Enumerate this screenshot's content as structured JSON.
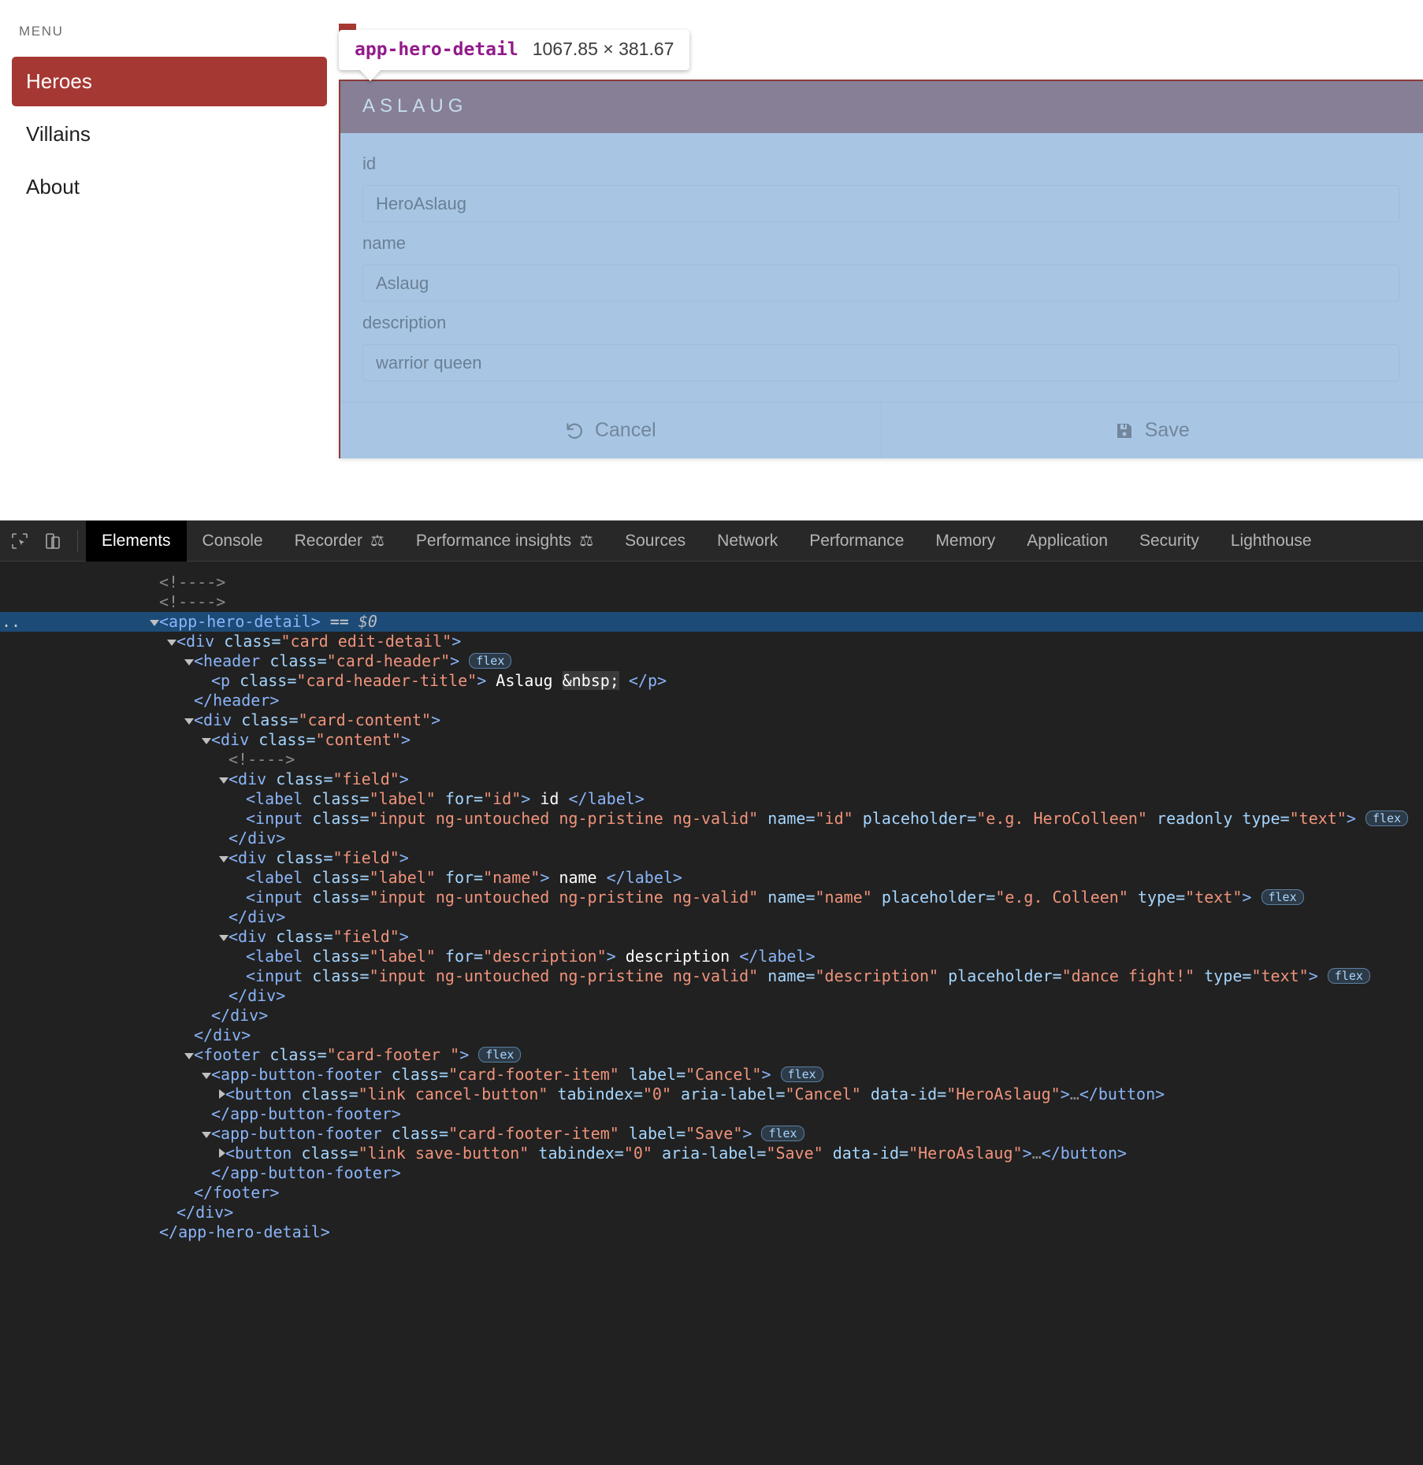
{
  "app": {
    "sidebar": {
      "menu_label": "MENU",
      "items": [
        {
          "label": "Heroes",
          "active": true
        },
        {
          "label": "Villains",
          "active": false
        },
        {
          "label": "About",
          "active": false
        }
      ]
    },
    "inspect_badge": {
      "tag": "app-hero-detail",
      "dimensions": "1067.85 × 381.67"
    },
    "card": {
      "title": "ASLAUG",
      "fields": [
        {
          "label": "id",
          "placeholder": "HeroAslaug"
        },
        {
          "label": "name",
          "placeholder": "Aslaug"
        },
        {
          "label": "description",
          "placeholder": "warrior queen"
        }
      ],
      "footer": {
        "cancel_label": "Cancel",
        "save_label": "Save"
      }
    }
  },
  "devtools": {
    "tabs": [
      {
        "label": "Elements",
        "active": true,
        "flask": false
      },
      {
        "label": "Console",
        "active": false,
        "flask": false
      },
      {
        "label": "Recorder",
        "active": false,
        "flask": true
      },
      {
        "label": "Performance insights",
        "active": false,
        "flask": true
      },
      {
        "label": "Sources",
        "active": false,
        "flask": false
      },
      {
        "label": "Network",
        "active": false,
        "flask": false
      },
      {
        "label": "Performance",
        "active": false,
        "flask": false
      },
      {
        "label": "Memory",
        "active": false,
        "flask": false
      },
      {
        "label": "Application",
        "active": false,
        "flask": false
      },
      {
        "label": "Security",
        "active": false,
        "flask": false
      },
      {
        "label": "Lighthouse",
        "active": false,
        "flask": false
      }
    ],
    "dom_lines": [
      {
        "indent": 1,
        "html": "<span class=\"cmt\">&lt;!----&gt;</span>"
      },
      {
        "indent": 1,
        "html": "<span class=\"cmt\">&lt;!----&gt;</span>"
      },
      {
        "indent": 1,
        "sel": true,
        "tri": "down",
        "html": "<span class=\"tag\">&lt;app-hero-detail&gt;</span> <span class=\"eq\">==</span> <span class=\"dollar\">$0</span>"
      },
      {
        "indent": 2,
        "tri": "down",
        "html": "<span class=\"tag\">&lt;div</span> <span class=\"attr\">class</span>=<span class=\"val\">\"card edit-detail\"</span><span class=\"tag\">&gt;</span>"
      },
      {
        "indent": 3,
        "tri": "down",
        "html": "<span class=\"tag\">&lt;header</span> <span class=\"attr\">class</span>=<span class=\"val\">\"card-header\"</span><span class=\"tag\">&gt;</span> <span class=\"flexbadge\">flex</span>"
      },
      {
        "indent": 4,
        "html": "<span class=\"tag\">&lt;p</span> <span class=\"attr\">class</span>=<span class=\"val\">\"card-header-title\"</span><span class=\"tag\">&gt;</span> <span class=\"txt\">Aslaug</span> <span class=\"nbsp-hl\">&amp;nbsp;</span> <span class=\"tag\">&lt;/p&gt;</span>"
      },
      {
        "indent": 3,
        "html": "<span class=\"tag\">&lt;/header&gt;</span>"
      },
      {
        "indent": 3,
        "tri": "down",
        "html": "<span class=\"tag\">&lt;div</span> <span class=\"attr\">class</span>=<span class=\"val\">\"card-content\"</span><span class=\"tag\">&gt;</span>"
      },
      {
        "indent": 4,
        "tri": "down",
        "html": "<span class=\"tag\">&lt;div</span> <span class=\"attr\">class</span>=<span class=\"val\">\"content\"</span><span class=\"tag\">&gt;</span>"
      },
      {
        "indent": 5,
        "html": "<span class=\"cmt\">&lt;!----&gt;</span>"
      },
      {
        "indent": 5,
        "tri": "down",
        "html": "<span class=\"tag\">&lt;div</span> <span class=\"attr\">class</span>=<span class=\"val\">\"field\"</span><span class=\"tag\">&gt;</span>"
      },
      {
        "indent": 6,
        "html": "<span class=\"tag\">&lt;label</span> <span class=\"attr\">class</span>=<span class=\"val\">\"label\"</span> <span class=\"attr\">for</span>=<span class=\"val\">\"id\"</span><span class=\"tag\">&gt;</span> <span class=\"txt\">id</span> <span class=\"tag\">&lt;/label&gt;</span>"
      },
      {
        "indent": 6,
        "html": "<span class=\"tag\">&lt;input</span> <span class=\"attr\">class</span>=<span class=\"val\">\"input ng-untouched ng-pristine ng-valid\"</span> <span class=\"attr\">name</span>=<span class=\"val\">\"id\"</span> <span class=\"attr\">placeholder</span>=<span class=\"val\">\"e.g. HeroColleen\"</span> <span class=\"attr\">readonly</span> <span class=\"attr\">type</span>=<span class=\"val\">\"text\"</span><span class=\"tag\">&gt;</span> <span class=\"flexbadge\">flex</span>"
      },
      {
        "indent": 5,
        "html": "<span class=\"tag\">&lt;/div&gt;</span>"
      },
      {
        "indent": 5,
        "tri": "down",
        "html": "<span class=\"tag\">&lt;div</span> <span class=\"attr\">class</span>=<span class=\"val\">\"field\"</span><span class=\"tag\">&gt;</span>"
      },
      {
        "indent": 6,
        "html": "<span class=\"tag\">&lt;label</span> <span class=\"attr\">class</span>=<span class=\"val\">\"label\"</span> <span class=\"attr\">for</span>=<span class=\"val\">\"name\"</span><span class=\"tag\">&gt;</span> <span class=\"txt\">name</span> <span class=\"tag\">&lt;/label&gt;</span>"
      },
      {
        "indent": 6,
        "html": "<span class=\"tag\">&lt;input</span> <span class=\"attr\">class</span>=<span class=\"val\">\"input ng-untouched ng-pristine ng-valid\"</span> <span class=\"attr\">name</span>=<span class=\"val\">\"name\"</span> <span class=\"attr\">placeholder</span>=<span class=\"val\">\"e.g. Colleen\"</span> <span class=\"attr\">type</span>=<span class=\"val\">\"text\"</span><span class=\"tag\">&gt;</span> <span class=\"flexbadge\">flex</span>"
      },
      {
        "indent": 5,
        "html": "<span class=\"tag\">&lt;/div&gt;</span>"
      },
      {
        "indent": 5,
        "tri": "down",
        "html": "<span class=\"tag\">&lt;div</span> <span class=\"attr\">class</span>=<span class=\"val\">\"field\"</span><span class=\"tag\">&gt;</span>"
      },
      {
        "indent": 6,
        "html": "<span class=\"tag\">&lt;label</span> <span class=\"attr\">class</span>=<span class=\"val\">\"label\"</span> <span class=\"attr\">for</span>=<span class=\"val\">\"description\"</span><span class=\"tag\">&gt;</span> <span class=\"txt\">description</span> <span class=\"tag\">&lt;/label&gt;</span>"
      },
      {
        "indent": 6,
        "html": "<span class=\"tag\">&lt;input</span> <span class=\"attr\">class</span>=<span class=\"val\">\"input ng-untouched ng-pristine ng-valid\"</span> <span class=\"attr\">name</span>=<span class=\"val\">\"description\"</span> <span class=\"attr\">placeholder</span>=<span class=\"val\">\"dance fight!\"</span> <span class=\"attr\">type</span>=<span class=\"val\">\"text\"</span><span class=\"tag\">&gt;</span> <span class=\"flexbadge\">flex</span>"
      },
      {
        "indent": 5,
        "html": "<span class=\"tag\">&lt;/div&gt;</span>"
      },
      {
        "indent": 4,
        "html": "<span class=\"tag\">&lt;/div&gt;</span>"
      },
      {
        "indent": 3,
        "html": "<span class=\"tag\">&lt;/div&gt;</span>"
      },
      {
        "indent": 3,
        "tri": "down",
        "html": "<span class=\"tag\">&lt;footer</span> <span class=\"attr\">class</span>=<span class=\"val\">\"card-footer \"</span><span class=\"tag\">&gt;</span> <span class=\"flexbadge\">flex</span>"
      },
      {
        "indent": 4,
        "tri": "down",
        "html": "<span class=\"tag\">&lt;app-button-footer</span> <span class=\"attr\">class</span>=<span class=\"val\">\"card-footer-item\"</span> <span class=\"attr\">label</span>=<span class=\"val\">\"Cancel\"</span><span class=\"tag\">&gt;</span> <span class=\"flexbadge\">flex</span>"
      },
      {
        "indent": 5,
        "tri": "right",
        "html": "<span class=\"tag\">&lt;button</span> <span class=\"attr\">class</span>=<span class=\"val\">\"link cancel-button\"</span> <span class=\"attr\">tabindex</span>=<span class=\"val\">\"0\"</span> <span class=\"attr\">aria-label</span>=<span class=\"val\">\"Cancel\"</span> <span class=\"attr\">data-id</span>=<span class=\"val\">\"HeroAslaug\"</span><span class=\"tag\">&gt;</span><span class=\"cmt\">…</span><span class=\"tag\">&lt;/button&gt;</span>"
      },
      {
        "indent": 4,
        "html": "<span class=\"tag\">&lt;/app-button-footer&gt;</span>"
      },
      {
        "indent": 4,
        "tri": "down",
        "html": "<span class=\"tag\">&lt;app-button-footer</span> <span class=\"attr\">class</span>=<span class=\"val\">\"card-footer-item\"</span> <span class=\"attr\">label</span>=<span class=\"val\">\"Save\"</span><span class=\"tag\">&gt;</span> <span class=\"flexbadge\">flex</span>"
      },
      {
        "indent": 5,
        "tri": "right",
        "html": "<span class=\"tag\">&lt;button</span> <span class=\"attr\">class</span>=<span class=\"val\">\"link save-button\"</span> <span class=\"attr\">tabindex</span>=<span class=\"val\">\"0\"</span> <span class=\"attr\">aria-label</span>=<span class=\"val\">\"Save\"</span> <span class=\"attr\">data-id</span>=<span class=\"val\">\"HeroAslaug\"</span><span class=\"tag\">&gt;</span><span class=\"cmt\">…</span><span class=\"tag\">&lt;/button&gt;</span>"
      },
      {
        "indent": 4,
        "html": "<span class=\"tag\">&lt;/app-button-footer&gt;</span>"
      },
      {
        "indent": 3,
        "html": "<span class=\"tag\">&lt;/footer&gt;</span>"
      },
      {
        "indent": 2,
        "html": "<span class=\"tag\">&lt;/div&gt;</span>"
      },
      {
        "indent": 1,
        "html": "<span class=\"tag\">&lt;/app-hero-detail&gt;</span>"
      }
    ]
  }
}
